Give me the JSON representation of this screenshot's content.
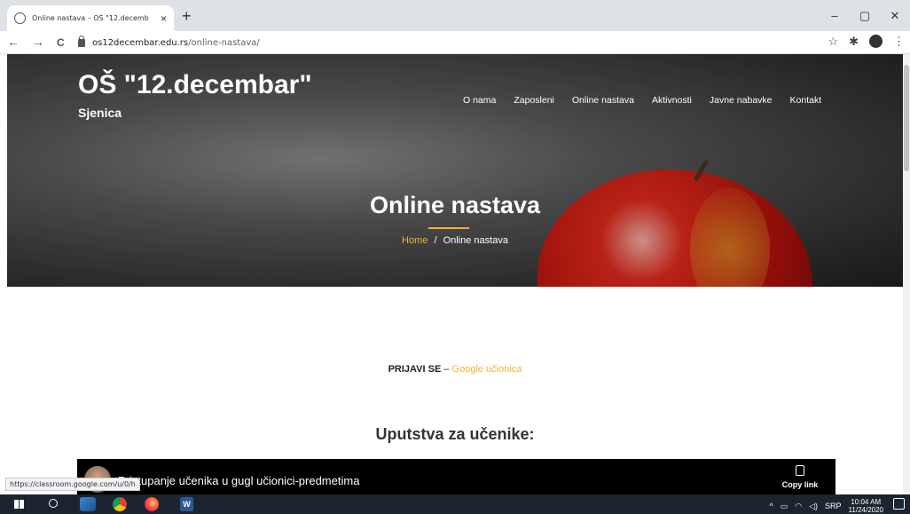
{
  "browser": {
    "tab_title": "Online nastava – OŠ \"12.decemb",
    "tab_close": "×",
    "new_tab": "+",
    "url_host": "os12decembar.edu.rs",
    "url_path": "/online-nastava/",
    "status_url": "https://classroom.google.com/u/0/h",
    "nav_back": "←",
    "nav_forward": "→",
    "nav_reload": "C",
    "star": "☆",
    "extensions": "✱",
    "menu": "⋮",
    "win_min": "–",
    "win_max": "▢",
    "win_close": "✕"
  },
  "site": {
    "title": "OŠ \"12.decembar\"",
    "subtitle": "Sjenica",
    "menu": [
      {
        "label": "O nama"
      },
      {
        "label": "Zaposleni"
      },
      {
        "label": "Online nastava"
      },
      {
        "label": "Aktivnosti"
      },
      {
        "label": "Javne nabavke"
      },
      {
        "label": "Kontakt"
      }
    ]
  },
  "hero": {
    "page_title": "Online nastava",
    "breadcrumb_home": "Home",
    "breadcrumb_sep": "/",
    "breadcrumb_current": "Online nastava"
  },
  "content": {
    "login_bold": "PRIJAVI SE",
    "login_dash": " – ",
    "login_link": "Google učionica",
    "heading": "Uputstva za učenike:",
    "video_title": "Pristupanje učenika u gugl učionici-predmetima",
    "copy_link": "Copy link"
  },
  "taskbar": {
    "word_label": "W",
    "tray_caret": "^",
    "tray_lang": "SRP",
    "time": "10:04 AM",
    "date": "11/24/2020"
  },
  "colors": {
    "accent": "#f0b432",
    "taskbar": "#1c2430",
    "video_bg": "#000000"
  }
}
